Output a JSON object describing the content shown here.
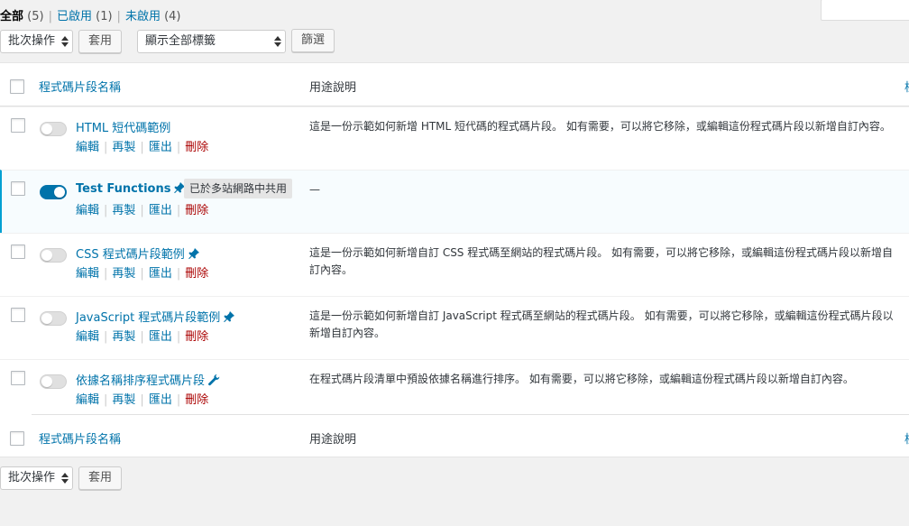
{
  "filters": {
    "all_label": "全部",
    "all_count": "(5)",
    "active_label": "已啟用",
    "active_count": "(1)",
    "inactive_label": "未啟用",
    "inactive_count": "(4)",
    "separator": "|"
  },
  "tablenav_top": {
    "bulk_actions": "批次操作",
    "apply": "套用",
    "tags_filter": "顯示全部標籤",
    "filter": "篩選"
  },
  "tablenav_bottom": {
    "bulk_actions": "批次操作",
    "apply": "套用"
  },
  "columns": {
    "name": "程式碼片段名稱",
    "description": "用途說明",
    "edge": "標"
  },
  "row_actions": {
    "edit": "編輯",
    "clone": "再製",
    "export": "匯出",
    "delete": "刪除",
    "separator": "|"
  },
  "snippets": [
    {
      "name": "HTML 短代碼範例",
      "active": false,
      "icon": "none",
      "description": "這是一份示範如何新增 HTML 短代碼的程式碼片段。 如有需要，可以將它移除，或編輯這份程式碼片段以新增自訂內容。"
    },
    {
      "name": "Test Functions",
      "active": true,
      "icon": "pin-icon",
      "badge": "已於多站網路中共用",
      "description": "—"
    },
    {
      "name": "CSS 程式碼片段範例",
      "active": false,
      "icon": "pin-icon",
      "description": "這是一份示範如何新增自訂 CSS 程式碼至網站的程式碼片段。 如有需要，可以將它移除，或編輯這份程式碼片段以新增自訂內容。"
    },
    {
      "name": "JavaScript 程式碼片段範例",
      "active": false,
      "icon": "pin-icon",
      "description": "這是一份示範如何新增自訂 JavaScript 程式碼至網站的程式碼片段。 如有需要，可以將它移除，或編輯這份程式碼片段以新增自訂內容。"
    },
    {
      "name": "依據名稱排序程式碼片段",
      "active": false,
      "icon": "wrench-icon",
      "description": "在程式碼片段清單中預設依據名稱進行排序。 如有需要，可以將它移除，或編輯這份程式碼片段以新增自訂內容。"
    }
  ],
  "colors": {
    "link": "#0073aa",
    "delete": "#aa0000",
    "active_border": "#00a0d2",
    "toggle_on": "#0073aa"
  }
}
